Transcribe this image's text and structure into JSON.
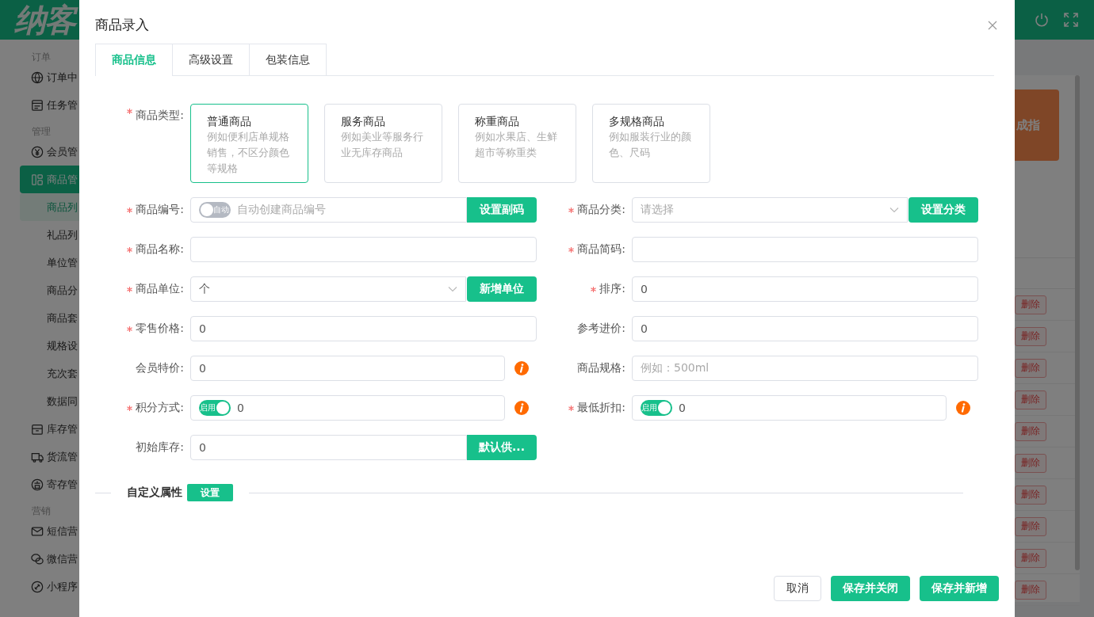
{
  "app": {
    "logo": "纳客",
    "sidebar": [
      {
        "title": "订单",
        "items": [
          {
            "label": "订单中",
            "selected": false
          },
          {
            "label": "任务管",
            "selected": false
          }
        ]
      },
      {
        "title": "管理",
        "items": [
          {
            "label": "会员管",
            "selected": false
          },
          {
            "label": "商品管",
            "selected": true,
            "expanded": true,
            "children": [
              {
                "label": "商品列",
                "selected": true
              },
              {
                "label": "礼品列",
                "selected": false
              },
              {
                "label": "单位管",
                "selected": false
              },
              {
                "label": "商品分",
                "selected": false
              },
              {
                "label": "商品套",
                "selected": false
              },
              {
                "label": "规格设",
                "selected": false
              },
              {
                "label": "充次套",
                "selected": false
              },
              {
                "label": "数据同",
                "selected": false
              }
            ]
          },
          {
            "label": "库存管",
            "selected": false
          },
          {
            "label": "货流管",
            "selected": false
          },
          {
            "label": "寄存管",
            "selected": false
          }
        ]
      },
      {
        "title": "营销",
        "items": [
          {
            "label": "短信营",
            "selected": false
          },
          {
            "label": "微信营",
            "selected": false
          },
          {
            "label": "小程序",
            "selected": false
          }
        ]
      }
    ],
    "banner": "成指",
    "row_actions": [
      "删除",
      "删除",
      "删除",
      "删除",
      "删除",
      "删除",
      "删除",
      "删除",
      "删除",
      "删除"
    ]
  },
  "dialog": {
    "title": "商品录入",
    "tabs": [
      {
        "label": "商品信息",
        "selected": true
      },
      {
        "label": "高级设置",
        "selected": false
      },
      {
        "label": "包装信息",
        "selected": false
      }
    ],
    "product_type": {
      "label": "商品类型:",
      "required": true,
      "options": [
        {
          "title": "普通商品",
          "description": "例如便利店单规格销售，不区分颜色等规格",
          "selected": true
        },
        {
          "title": "服务商品",
          "description": "例如美业等服务行业无库存商品",
          "selected": false
        },
        {
          "title": "称重商品",
          "description": "例如水果店、生鲜超市等称重类",
          "selected": false
        },
        {
          "title": "多规格商品",
          "description": "例如服装行业的颜色、尺码",
          "selected": false
        }
      ]
    },
    "rows": [
      [
        {
          "label": "商品编号:",
          "required": true,
          "kind": "toggle",
          "toggle": {
            "label": "自动",
            "on": false
          },
          "placeholder": "自动创建商品编号",
          "button": "设置副码"
        },
        {
          "label": "商品分类:",
          "required": true,
          "kind": "select",
          "placeholder": "请选择",
          "button": "设置分类"
        }
      ],
      [
        {
          "label": "商品名称:",
          "required": true,
          "kind": "text"
        },
        {
          "label": "商品简码:",
          "required": true,
          "kind": "text"
        }
      ],
      [
        {
          "label": "商品单位:",
          "required": true,
          "kind": "select",
          "value": "个",
          "button": "新增单位"
        },
        {
          "label": "排序:",
          "required": true,
          "kind": "text",
          "value": "0"
        }
      ],
      [
        {
          "label": "零售价格:",
          "required": true,
          "kind": "text",
          "value": "0"
        },
        {
          "label": "参考进价:",
          "required": false,
          "kind": "text",
          "value": "0"
        }
      ],
      [
        {
          "label": "会员特价:",
          "required": false,
          "kind": "text",
          "value": "0",
          "info": true
        },
        {
          "label": "商品规格:",
          "required": false,
          "kind": "text",
          "placeholder": "例如：500ml"
        }
      ],
      [
        {
          "label": "积分方式:",
          "required": true,
          "kind": "toggle",
          "toggle": {
            "label": "启用",
            "on": true
          },
          "value": "0",
          "info": true
        },
        {
          "label": "最低折扣:",
          "required": true,
          "kind": "toggle",
          "toggle": {
            "label": "启用",
            "on": true
          },
          "value": "0",
          "info": true
        }
      ],
      [
        {
          "label": "初始库存:",
          "required": false,
          "kind": "text",
          "value": "0",
          "button": "默认供..."
        }
      ]
    ],
    "custom_attributes": {
      "label": "自定义属性",
      "button": "设置"
    },
    "buttons": [
      {
        "label": "取消",
        "kind": "plain"
      },
      {
        "label": "保存并关闭",
        "kind": "primary"
      },
      {
        "label": "保存并新增",
        "kind": "primary"
      }
    ]
  }
}
